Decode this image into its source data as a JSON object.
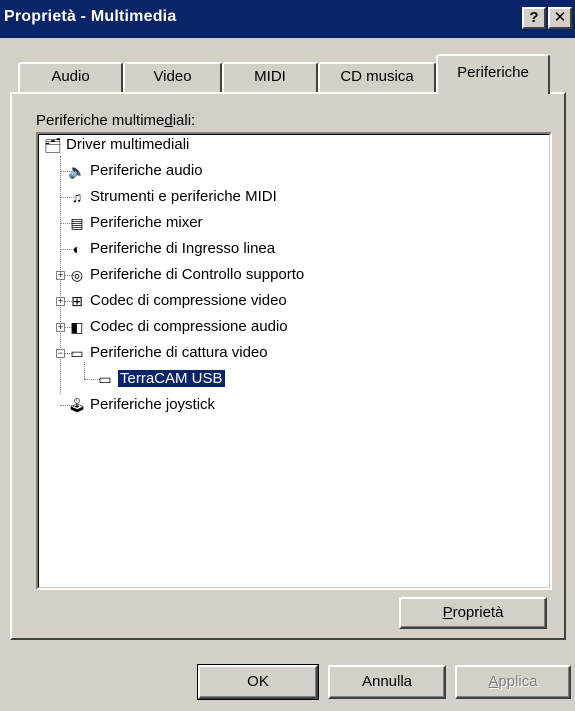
{
  "window": {
    "title": "Proprietà - Multimedia",
    "help_label": "?",
    "close_label": "✕"
  },
  "tabs": [
    {
      "label": "Audio",
      "active": false
    },
    {
      "label": "Video",
      "active": false
    },
    {
      "label": "MIDI",
      "active": false
    },
    {
      "label": "CD musica",
      "active": false
    },
    {
      "label": "Periferiche",
      "active": true
    }
  ],
  "devices_panel": {
    "label_prefix": "Periferiche multime",
    "label_accel": "d",
    "label_suffix": "iali:",
    "tree": {
      "root": {
        "label": "Driver multimediali",
        "icon": "multimedia-drivers-icon"
      },
      "items": [
        {
          "label": "Periferiche audio",
          "icon": "speaker-icon",
          "expandable": false
        },
        {
          "label": "Strumenti e periferiche MIDI",
          "icon": "midi-icon",
          "expandable": false
        },
        {
          "label": "Periferiche mixer",
          "icon": "mixer-icon",
          "expandable": false
        },
        {
          "label": "Periferiche di Ingresso linea",
          "icon": "line-in-icon",
          "expandable": false
        },
        {
          "label": "Periferiche di Controllo supporto",
          "icon": "media-control-icon",
          "expandable": true,
          "expanded": false
        },
        {
          "label": "Codec di compressione video",
          "icon": "video-codec-icon",
          "expandable": true,
          "expanded": false
        },
        {
          "label": "Codec di compressione audio",
          "icon": "audio-codec-icon",
          "expandable": true,
          "expanded": false
        },
        {
          "label": "Periferiche di cattura video",
          "icon": "video-capture-icon",
          "expandable": true,
          "expanded": true
        },
        {
          "label": "TerraCAM USB",
          "icon": "camera-icon",
          "selected": true
        },
        {
          "label": "Periferiche joystick",
          "icon": "joystick-icon",
          "expandable": false
        }
      ]
    },
    "properties_prefix": "",
    "properties_accel": "P",
    "properties_suffix": "roprietà"
  },
  "footer": {
    "ok_label": "OK",
    "cancel_label": "Annulla",
    "apply_prefix": "",
    "apply_accel": "A",
    "apply_suffix": "pplica"
  },
  "colors": {
    "titlebar": "#0a246a",
    "face": "#d4d0c8",
    "selection": "#0a246a"
  }
}
